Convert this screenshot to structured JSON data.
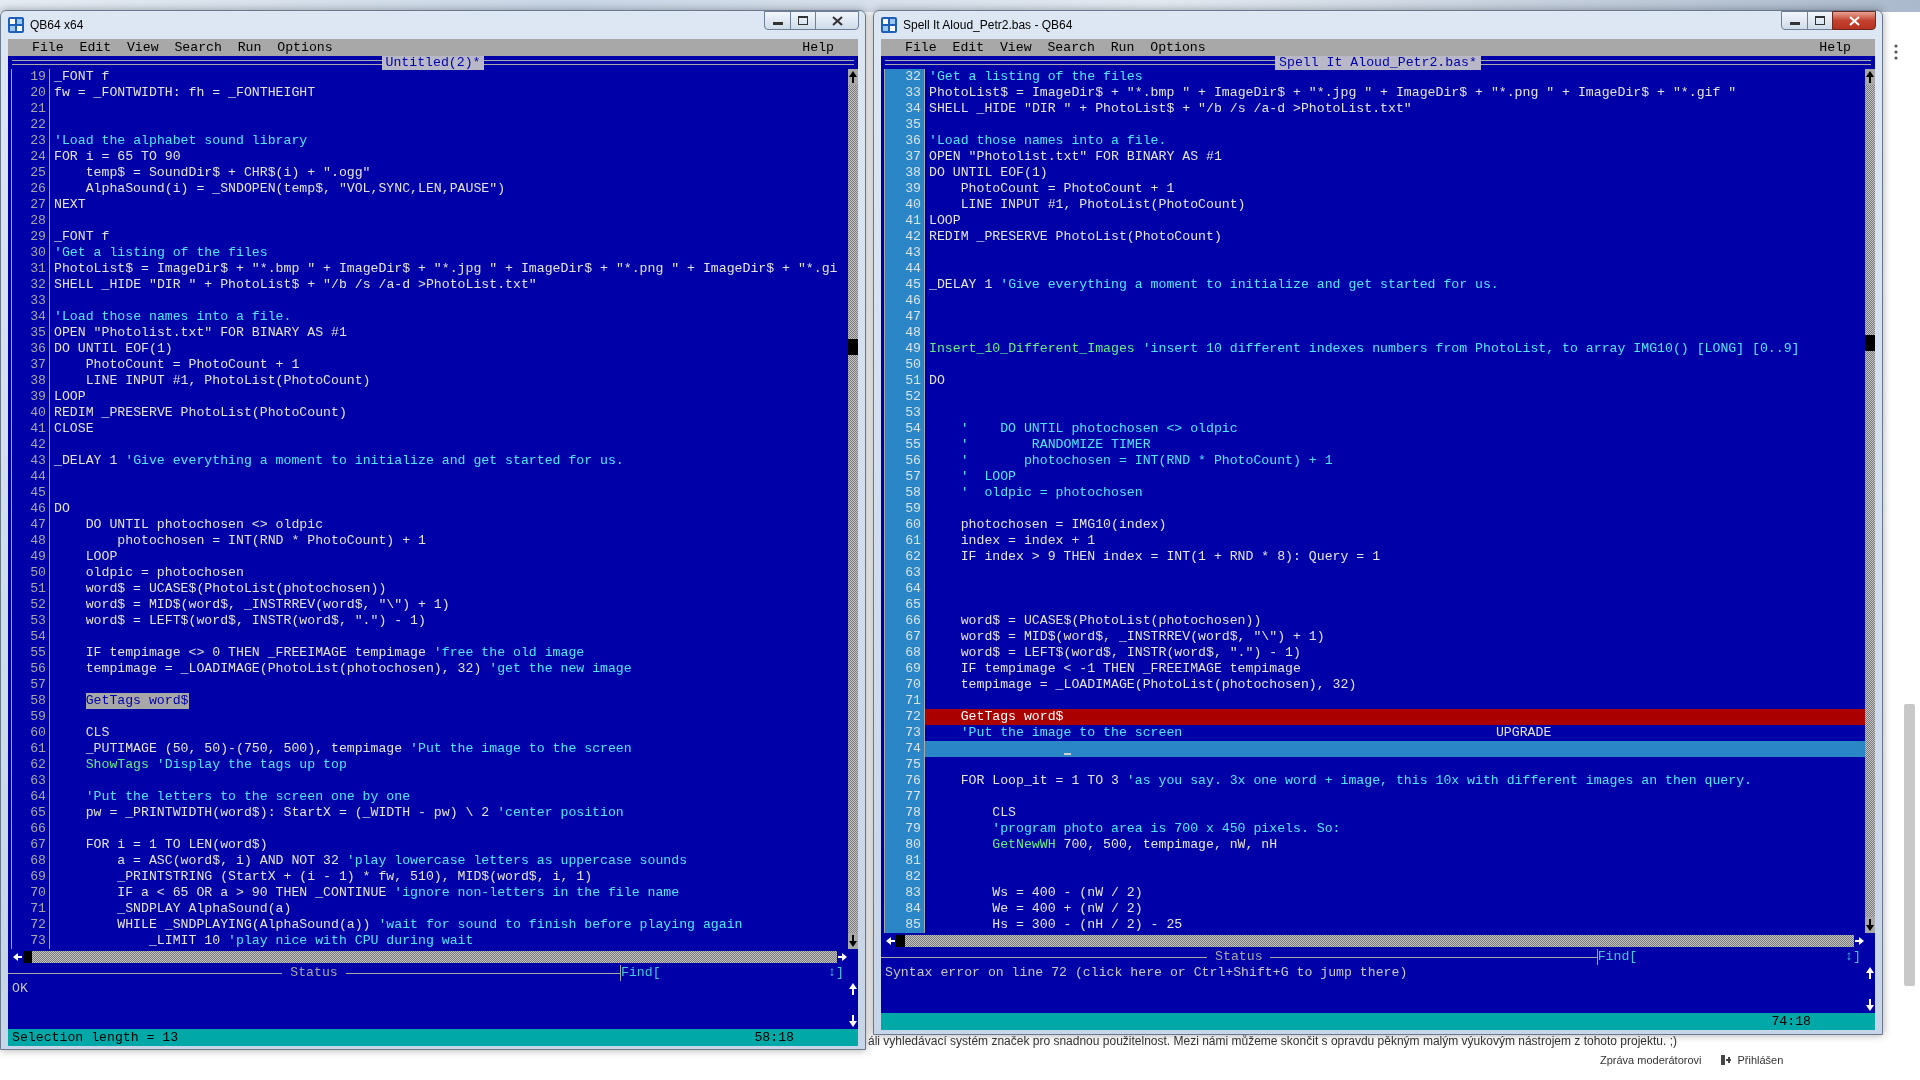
{
  "backdrop": {
    "forum_text": "áli vyhledávací systém značek pro snadnou použitelnost. Mezi námi můžeme skončit s opravdu pěkným malým výukovým nástrojem z tohoto projektu. ;)",
    "report_link": "Zpráva moderátorovi",
    "login_status": "Přihlášen"
  },
  "windows": [
    {
      "title": "QB64 x64",
      "active": false,
      "menu": [
        "File",
        "Edit",
        "View",
        "Search",
        "Run",
        "Options"
      ],
      "help": "Help",
      "document_title": "Untitled(2)*",
      "gutter_shaded": false,
      "lines": [
        {
          "n": "19",
          "code": "_FONT f"
        },
        {
          "n": "20",
          "code": "fw = _FONTWIDTH: fh = _FONTHEIGHT"
        },
        {
          "n": "21"
        },
        {
          "n": "22"
        },
        {
          "n": "23",
          "comment": "'Load the alphabet sound library"
        },
        {
          "n": "24",
          "code": "FOR i = 65 TO 90"
        },
        {
          "n": "25",
          "code": "    temp$ = SoundDir$ + CHR$(i) + \".ogg\""
        },
        {
          "n": "26",
          "code": "    AlphaSound(i) = _SNDOPEN(temp$, \"VOL,SYNC,LEN,PAUSE\")"
        },
        {
          "n": "27",
          "code": "NEXT"
        },
        {
          "n": "28"
        },
        {
          "n": "29",
          "code": "_FONT f"
        },
        {
          "n": "30",
          "comment": "'Get a listing of the files"
        },
        {
          "n": "31",
          "code": "PhotoList$ = ImageDir$ + \"*.bmp \" + ImageDir$ + \"*.jpg \" + ImageDir$ + \"*.png \" + ImageDir$ + \"*.gi"
        },
        {
          "n": "32",
          "code": "SHELL _HIDE \"DIR \" + PhotoList$ + \"/b /s /a-d >PhotoList.txt\""
        },
        {
          "n": "33"
        },
        {
          "n": "34",
          "comment": "'Load those names into a file."
        },
        {
          "n": "35",
          "code": "OPEN \"Photolist.txt\" FOR BINARY AS #1"
        },
        {
          "n": "36",
          "code": "DO UNTIL EOF(1)"
        },
        {
          "n": "37",
          "code": "    PhotoCount = PhotoCount + 1"
        },
        {
          "n": "38",
          "code": "    LINE INPUT #1, PhotoList(PhotoCount)"
        },
        {
          "n": "39",
          "code": "LOOP"
        },
        {
          "n": "40",
          "code": "REDIM _PRESERVE PhotoList(PhotoCount)"
        },
        {
          "n": "41",
          "code": "CLOSE"
        },
        {
          "n": "42"
        },
        {
          "n": "43",
          "code": "_DELAY 1",
          "comment": "'Give everything a moment to initialize and get started for us."
        },
        {
          "n": "44"
        },
        {
          "n": "45"
        },
        {
          "n": "46",
          "code": "DO"
        },
        {
          "n": "47",
          "code": "    DO UNTIL photochosen <> oldpic"
        },
        {
          "n": "48",
          "code": "        photochosen = INT(RND * PhotoCount) + 1"
        },
        {
          "n": "49",
          "code": "    LOOP"
        },
        {
          "n": "50",
          "code": "    oldpic = photochosen"
        },
        {
          "n": "51",
          "code": "    word$ = UCASE$(PhotoList(photochosen))"
        },
        {
          "n": "52",
          "code": "    word$ = MID$(word$, _INSTRREV(word$, \"\\\") + 1)"
        },
        {
          "n": "53",
          "code": "    word$ = LEFT$(word$, INSTR(word$, \".\") - 1)"
        },
        {
          "n": "54"
        },
        {
          "n": "55",
          "code": "    IF tempimage <> 0 THEN _FREEIMAGE tempimage",
          "comment": "'free the old image"
        },
        {
          "n": "56",
          "code": "    tempimage = _LOADIMAGE(PhotoList(photochosen), 32)",
          "comment": "'get the new image"
        },
        {
          "n": "57"
        },
        {
          "n": "58",
          "code": "    GetTags word$",
          "selection": true
        },
        {
          "n": "59"
        },
        {
          "n": "60",
          "code": "    CLS"
        },
        {
          "n": "61",
          "code": "    _PUTIMAGE (50, 50)-(750, 500), tempimage",
          "comment": "'Put the image to the screen"
        },
        {
          "n": "62",
          "call": "    ShowTags",
          "comment": "'Display the tags up top"
        },
        {
          "n": "63"
        },
        {
          "n": "64",
          "comment": "    'Put the letters to the screen one by one"
        },
        {
          "n": "65",
          "code": "    pw = _PRINTWIDTH(word$): StartX = (_WIDTH - pw) \\ 2",
          "comment": "'center position"
        },
        {
          "n": "66"
        },
        {
          "n": "67",
          "code": "    FOR i = 1 TO LEN(word$)"
        },
        {
          "n": "68",
          "code": "        a = ASC(word$, i) AND NOT 32",
          "comment": "'play lowercase letters as uppercase sounds"
        },
        {
          "n": "69",
          "code": "        _PRINTSTRING (StartX + (i - 1) * fw, 510), MID$(word$, i, 1)"
        },
        {
          "n": "70",
          "code": "        IF a < 65 OR a > 90 THEN _CONTINUE",
          "comment": "'ignore non-letters in the file name"
        },
        {
          "n": "71",
          "code": "        _SNDPLAY AlphaSound(a)"
        },
        {
          "n": "72",
          "code": "        WHILE _SNDPLAYING(AlphaSound(a))",
          "comment": "'wait for sound to finish before playing again"
        },
        {
          "n": "73",
          "code": "            _LIMIT 10",
          "comment": "'play nice with CPU during wait"
        }
      ],
      "status_label": "Status",
      "find_label": "Find[",
      "find_toggle": "↕]",
      "messages": [
        "OK"
      ],
      "selection_info": "Selection length = 13",
      "position": "58:18"
    },
    {
      "title": "Spell It Aloud_Petr2.bas - QB64",
      "active": true,
      "menu": [
        "File",
        "Edit",
        "View",
        "Search",
        "Run",
        "Options"
      ],
      "help": "Help",
      "document_title": "Spell It Aloud_Petr2.bas*",
      "gutter_shaded": true,
      "lines": [
        {
          "n": "32",
          "comment": "'Get a listing of the files"
        },
        {
          "n": "33",
          "code": "PhotoList$ = ImageDir$ + \"*.bmp \" + ImageDir$ + \"*.jpg \" + ImageDir$ + \"*.png \" + ImageDir$ + \"*.gif \""
        },
        {
          "n": "34",
          "code": "SHELL _HIDE \"DIR \" + PhotoList$ + \"/b /s /a-d >PhotoList.txt\""
        },
        {
          "n": "35"
        },
        {
          "n": "36",
          "comment": "'Load those names into a file."
        },
        {
          "n": "37",
          "code": "OPEN \"Photolist.txt\" FOR BINARY AS #1"
        },
        {
          "n": "38",
          "code": "DO UNTIL EOF(1)"
        },
        {
          "n": "39",
          "code": "    PhotoCount = PhotoCount + 1"
        },
        {
          "n": "40",
          "code": "    LINE INPUT #1, PhotoList(PhotoCount)"
        },
        {
          "n": "41",
          "code": "LOOP"
        },
        {
          "n": "42",
          "code": "REDIM _PRESERVE PhotoList(PhotoCount)"
        },
        {
          "n": "43"
        },
        {
          "n": "44"
        },
        {
          "n": "45",
          "code": "_DELAY 1",
          "comment": "'Give everything a moment to initialize and get started for us."
        },
        {
          "n": "46"
        },
        {
          "n": "47"
        },
        {
          "n": "48"
        },
        {
          "n": "49",
          "call": "Insert_10_Different_Images",
          "comment": "'insert 10 different indexes numbers from PhotoList, to array IMG10() [LONG] [0..9]"
        },
        {
          "n": "50"
        },
        {
          "n": "51",
          "code": "DO"
        },
        {
          "n": "52"
        },
        {
          "n": "53"
        },
        {
          "n": "54",
          "comment": "    '    DO UNTIL photochosen <> oldpic"
        },
        {
          "n": "55",
          "comment": "    '        RANDOMIZE TIMER"
        },
        {
          "n": "56",
          "comment": "    '       photochosen = INT(RND * PhotoCount) + 1"
        },
        {
          "n": "57",
          "comment": "    '  LOOP"
        },
        {
          "n": "58",
          "comment": "    '  oldpic = photochosen"
        },
        {
          "n": "59"
        },
        {
          "n": "60",
          "code": "    photochosen = IMG10(index)"
        },
        {
          "n": "61",
          "code": "    index = index + 1"
        },
        {
          "n": "62",
          "code": "    IF index > 9 THEN index = INT(1 + RND * 8): Query = 1"
        },
        {
          "n": "63"
        },
        {
          "n": "64"
        },
        {
          "n": "65"
        },
        {
          "n": "66",
          "code": "    word$ = UCASE$(PhotoList(photochosen))"
        },
        {
          "n": "67",
          "code": "    word$ = MID$(word$, _INSTRREV(word$, \"\\\") + 1)"
        },
        {
          "n": "68",
          "code": "    word$ = LEFT$(word$, INSTR(word$, \".\") - 1)"
        },
        {
          "n": "69",
          "code": "    IF tempimage < -1 THEN _FREEIMAGE tempimage"
        },
        {
          "n": "70",
          "code": "    tempimage = _LOADIMAGE(PhotoList(photochosen), 32)"
        },
        {
          "n": "71"
        },
        {
          "n": "72",
          "code": "    GetTags word$",
          "error": true
        },
        {
          "n": "73",
          "comment": "    'Put the image to the screen",
          "note": "UPGRADE"
        },
        {
          "n": "74",
          "current": true,
          "cursor": true
        },
        {
          "n": "75"
        },
        {
          "n": "76",
          "code": "    FOR Loop_it = 1 TO 3",
          "comment": "'as you say. 3x one word + image, this 10x with different images an then query."
        },
        {
          "n": "77"
        },
        {
          "n": "78",
          "code": "        CLS"
        },
        {
          "n": "79",
          "comment": "        'program photo area is 700 x 450 pixels. So:"
        },
        {
          "n": "80",
          "call": "        GetNewWH",
          "code": "700, 500, tempimage, nW, nH"
        },
        {
          "n": "81"
        },
        {
          "n": "82"
        },
        {
          "n": "83",
          "code": "        Ws = 400 - (nW / 2)"
        },
        {
          "n": "84",
          "code": "        We = 400 + (nW / 2)"
        },
        {
          "n": "85",
          "code": "        Hs = 300 - (nH / 2) - 25"
        }
      ],
      "status_label": "Status",
      "find_label": "Find[",
      "find_toggle": "↕]",
      "messages": [
        "Syntax error on line 72 (click here or Ctrl+Shift+G to jump there)"
      ],
      "position": "74:18"
    }
  ]
}
